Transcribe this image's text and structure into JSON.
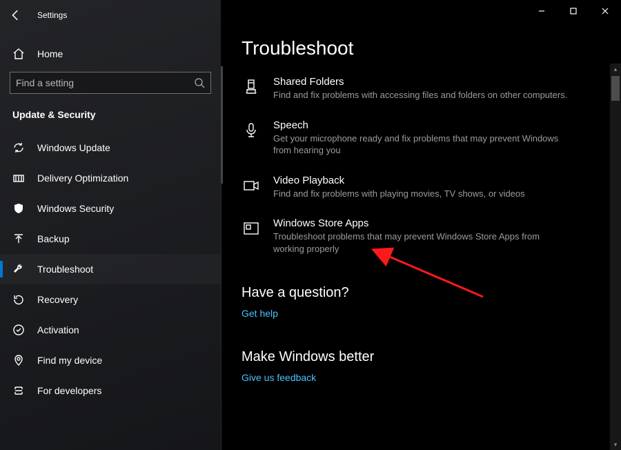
{
  "window": {
    "title": "Settings"
  },
  "sidebar": {
    "home": "Home",
    "search_placeholder": "Find a setting",
    "section_title": "Update & Security",
    "items": [
      {
        "name": "windows-update",
        "label": "Windows Update"
      },
      {
        "name": "delivery-optimization",
        "label": "Delivery Optimization"
      },
      {
        "name": "windows-security",
        "label": "Windows Security"
      },
      {
        "name": "backup",
        "label": "Backup"
      },
      {
        "name": "troubleshoot",
        "label": "Troubleshoot",
        "selected": true
      },
      {
        "name": "recovery",
        "label": "Recovery"
      },
      {
        "name": "activation",
        "label": "Activation"
      },
      {
        "name": "find-my-device",
        "label": "Find my device"
      },
      {
        "name": "for-developers",
        "label": "For developers"
      }
    ]
  },
  "page": {
    "title": "Troubleshoot",
    "troubleshooters": [
      {
        "name": "shared-folders",
        "title": "Shared Folders",
        "desc": "Find and fix problems with accessing files and folders on other computers."
      },
      {
        "name": "speech",
        "title": "Speech",
        "desc": "Get your microphone ready and fix problems that may prevent Windows from hearing you"
      },
      {
        "name": "video-playback",
        "title": "Video Playback",
        "desc": "Find and fix problems with playing movies, TV shows, or videos"
      },
      {
        "name": "windows-store-apps",
        "title": "Windows Store Apps",
        "desc": "Troubleshoot problems that may prevent Windows Store Apps from working properly"
      }
    ],
    "question_heading": "Have a question?",
    "question_link": "Get help",
    "better_heading": "Make Windows better",
    "better_link": "Give us feedback"
  }
}
